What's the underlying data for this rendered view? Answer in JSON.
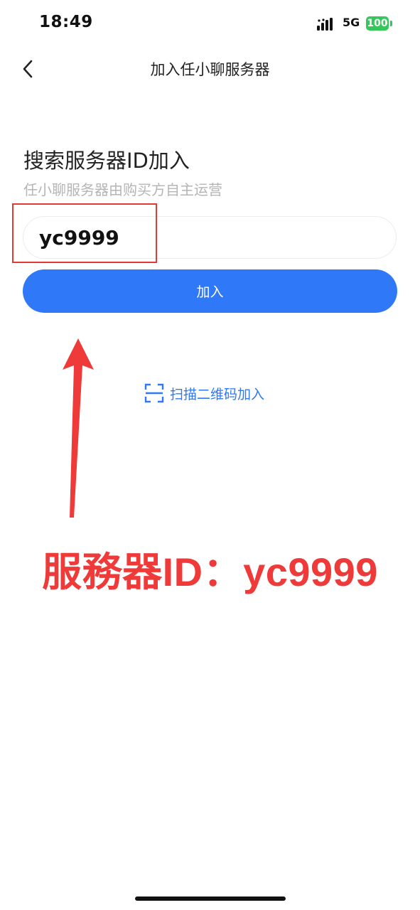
{
  "status_bar": {
    "time": "18:49",
    "network": "5G",
    "battery": "100",
    "signal_icon": "cellular-signal-icon",
    "battery_color": "#34c759"
  },
  "nav": {
    "title": "加入任小聊服务器",
    "back_icon": "chevron-left-icon"
  },
  "search": {
    "title": "搜索服务器ID加入",
    "subtitle": "任小聊服务器由购买方自主运营",
    "input_value": "yc9999"
  },
  "join_button": {
    "label": "加入",
    "color": "#2f78f7"
  },
  "scan": {
    "label": "扫描二维码加入",
    "icon": "qr-scan-icon"
  },
  "annotation": {
    "text": "服務器ID：yc9999",
    "color": "#ef3a3a"
  }
}
